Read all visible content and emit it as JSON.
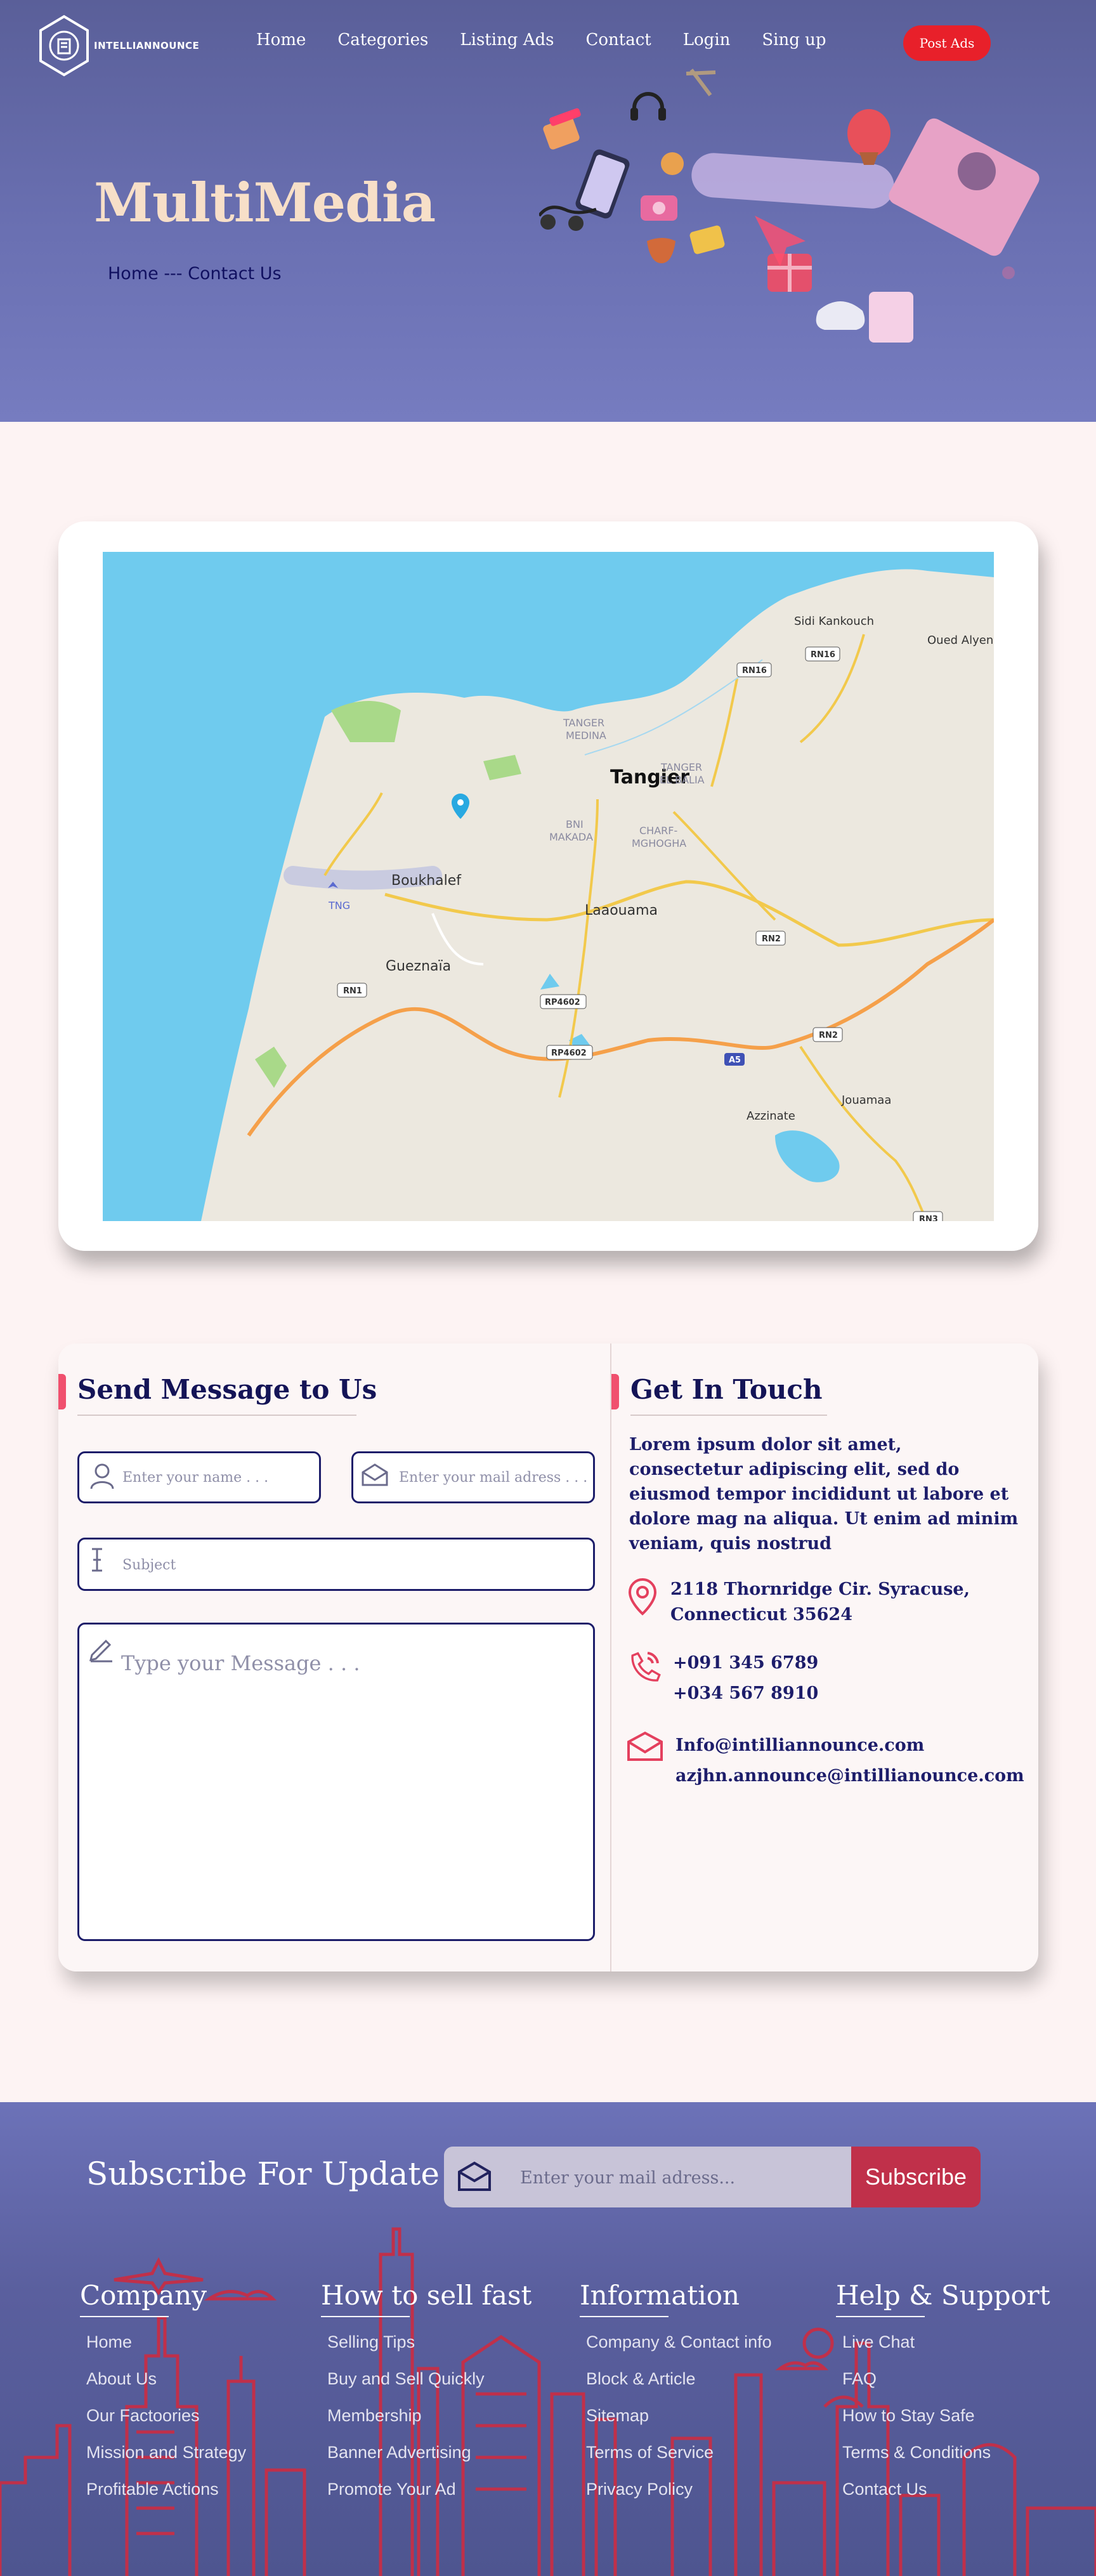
{
  "brand": {
    "name": "INTELLIANNOUNCE"
  },
  "nav": {
    "items": [
      "Home",
      "Categories",
      "Listing Ads",
      "Contact",
      "Login",
      "Sing up"
    ],
    "post_ads": "Post Ads"
  },
  "hero": {
    "title": "MultiMedia",
    "breadcrumb": "Home --- Contact Us"
  },
  "map": {
    "labels": {
      "city": "Tangier",
      "medina": [
        "TANGER",
        "MEDINA"
      ],
      "elbalia": [
        "TANGER",
        "EL BALIA"
      ],
      "bni": [
        "BNI",
        "MAKADA"
      ],
      "charf": [
        "CHARF-",
        "MGHOGHA"
      ],
      "boukhalef": "Boukhalef",
      "tng": "TNG",
      "laaouama": "Laaouama",
      "gueznaia": "Gueznaïa",
      "sidi": "Sidi Kankouch",
      "oued": "Oued Alyen",
      "azzinate": "Azzinate",
      "jouamaa": "Jouamaa"
    },
    "road_labels": [
      "RN16",
      "RN16",
      "RN2",
      "RN1",
      "RP4602",
      "RP4602",
      "A5",
      "RN2",
      "RN3"
    ]
  },
  "send_message": {
    "title": "Send Message to Us",
    "name_placeholder": "Enter your name . . .",
    "email_placeholder": "Enter your mail adress . . .",
    "subject_placeholder": "Subject",
    "message_placeholder": "Type your Message . . ."
  },
  "get_in_touch": {
    "title": "Get In Touch",
    "text": "Lorem ipsum dolor sit amet, consectetur adipiscing elit, sed do eiusmod tempor incididunt ut labore et dolore mag na aliqua. Ut enim ad minim veniam, quis nostrud",
    "address": [
      "2118 Thornridge Cir. Syracuse,",
      "Connecticut 35624"
    ],
    "phones": [
      "+091 345 6789",
      "+034 567 8910"
    ],
    "emails": [
      "Info@intilliannounce.com",
      "azjhn.announce@intillianounce.com"
    ]
  },
  "subscribe": {
    "title": "Subscribe For Update",
    "placeholder": "Enter your mail adress...",
    "button": "Subscribe"
  },
  "footer": {
    "columns": [
      {
        "title": "Company",
        "links": [
          "Home",
          "About Us",
          "Our Factoories",
          "Mission and Strategy",
          "Profitable Actions"
        ]
      },
      {
        "title": "How to sell fast",
        "links": [
          "Selling Tips",
          "Buy and Sell Quickly",
          "Membership",
          "Banner Advertising",
          "Promote Your Ad"
        ]
      },
      {
        "title": "Information",
        "links": [
          "Company & Contact info",
          "Block & Article",
          "Sitemap",
          "Terms of Service",
          "Privacy Policy"
        ]
      },
      {
        "title": "Help & Support",
        "links": [
          "Live Chat",
          "FAQ",
          "How to Stay Safe",
          "Terms & Conditions",
          "Contact Us"
        ]
      }
    ]
  },
  "colors": {
    "hero_bg": "#6a70b2",
    "accent_red": "#e8202a",
    "title_cream": "#f7dfc8",
    "navy": "#1d1d6a",
    "pink_accent": "#f0506e",
    "subscribe_button": "#c0304a",
    "page_bg": "#fdf3f3"
  }
}
